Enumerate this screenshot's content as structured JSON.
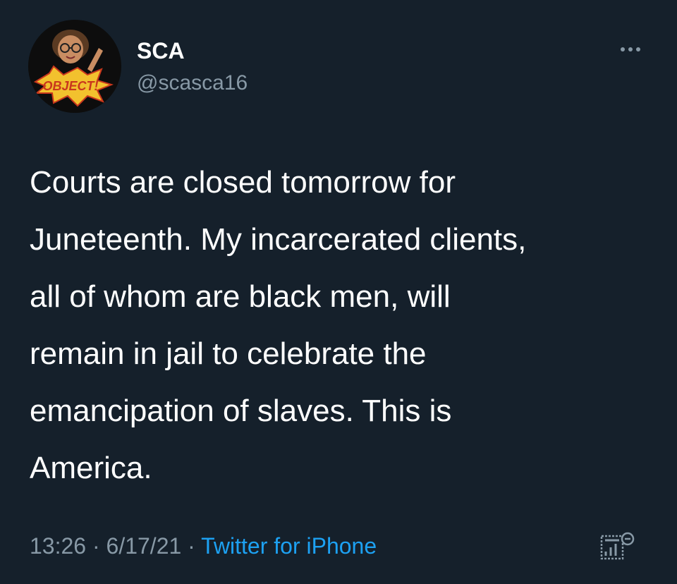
{
  "tweet": {
    "display_name": "SCA",
    "handle": "@scasca16",
    "avatar_badge_text": "OBJECT!",
    "text": "Courts are closed tomorrow for\nJuneteenth. My incarcerated clients,\nall of whom are black men, will\nremain in jail to celebrate the\nemancipation of slaves. This is\nAmerica.",
    "time": "13:26",
    "date": "6/17/21",
    "separator": "·",
    "source": "Twitter for iPhone"
  },
  "icons": {
    "more": "more-horizontal-icon",
    "analytics": "analytics-icon"
  },
  "colors": {
    "background": "#15202b",
    "primary_text": "#ffffff",
    "secondary_text": "#8899a6",
    "link": "#1da1f2"
  }
}
